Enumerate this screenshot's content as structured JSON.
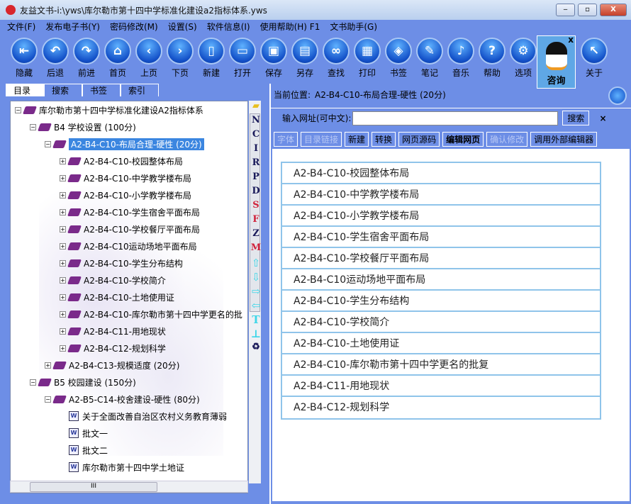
{
  "window": {
    "title": "友益文书-i:\\yws\\库尔勒市第十四中学标准化建设a2指标体系.yws",
    "min": "‒",
    "max": "▫",
    "close": "X"
  },
  "menu": [
    "文件(F)",
    "发布电子书(Y)",
    "密码修改(M)",
    "设置(S)",
    "软件信息(I)",
    "使用帮助(H) F1",
    "文书助手(G)"
  ],
  "toolbar": [
    {
      "label": "隐藏",
      "glyph": "⇤"
    },
    {
      "label": "后退",
      "glyph": "↶"
    },
    {
      "label": "前进",
      "glyph": "↷"
    },
    {
      "label": "首页",
      "glyph": "⌂"
    },
    {
      "label": "上页",
      "glyph": "‹"
    },
    {
      "label": "下页",
      "glyph": "›"
    },
    {
      "label": "新建",
      "glyph": "▯"
    },
    {
      "label": "打开",
      "glyph": "▭"
    },
    {
      "label": "保存",
      "glyph": "▣"
    },
    {
      "label": "另存",
      "glyph": "▤"
    },
    {
      "label": "查找",
      "glyph": "∞"
    },
    {
      "label": "打印",
      "glyph": "▦"
    },
    {
      "label": "书签",
      "glyph": "◈"
    },
    {
      "label": "笔记",
      "glyph": "✎"
    },
    {
      "label": "音乐",
      "glyph": "♪"
    },
    {
      "label": "帮助",
      "glyph": "?"
    },
    {
      "label": "选项",
      "glyph": "⚙"
    },
    {
      "label": "关于",
      "glyph": "↖"
    }
  ],
  "qq": {
    "label": "咨询",
    "close": "x"
  },
  "tabs": [
    "目录",
    "搜索",
    "书签",
    "索引"
  ],
  "tree": [
    {
      "level": 0,
      "pm": "−",
      "type": "book",
      "text": "库尔勒市第十四中学标准化建设A2指标体系"
    },
    {
      "level": 1,
      "pm": "−",
      "type": "book",
      "text": "B4 学校设置 (100分)"
    },
    {
      "level": 2,
      "pm": "−",
      "type": "open",
      "text": "A2-B4-C10-布局合理-硬性 (20分)",
      "selected": true
    },
    {
      "level": 3,
      "pm": "+",
      "type": "book",
      "text": "A2-B4-C10-校园整体布局"
    },
    {
      "level": 3,
      "pm": "+",
      "type": "book",
      "text": "A2-B4-C10-中学教学楼布局"
    },
    {
      "level": 3,
      "pm": "+",
      "type": "book",
      "text": "A2-B4-C10-小学教学楼布局"
    },
    {
      "level": 3,
      "pm": "+",
      "type": "book",
      "text": "A2-B4-C10-学生宿舍平面布局"
    },
    {
      "level": 3,
      "pm": "+",
      "type": "book",
      "text": "A2-B4-C10-学校餐厅平面布局"
    },
    {
      "level": 3,
      "pm": "+",
      "type": "book",
      "text": "A2-B4-C10运动场地平面布局"
    },
    {
      "level": 3,
      "pm": "+",
      "type": "book",
      "text": "A2-B4-C10-学生分布结构"
    },
    {
      "level": 3,
      "pm": "+",
      "type": "book",
      "text": "A2-B4-C10-学校简介"
    },
    {
      "level": 3,
      "pm": "+",
      "type": "book",
      "text": "A2-B4-C10-土地使用证"
    },
    {
      "level": 3,
      "pm": "+",
      "type": "book",
      "text": "A2-B4-C10-库尔勒市第十四中学更名的批"
    },
    {
      "level": 3,
      "pm": "+",
      "type": "book",
      "text": "A2-B4-C11-用地现状"
    },
    {
      "level": 3,
      "pm": "+",
      "type": "book",
      "text": "A2-B4-C12-规划科学"
    },
    {
      "level": 2,
      "pm": "+",
      "type": "book",
      "text": "A2-B4-C13-规模适度 (20分)"
    },
    {
      "level": 1,
      "pm": "−",
      "type": "book",
      "text": "B5 校园建设 (150分)"
    },
    {
      "level": 2,
      "pm": "−",
      "type": "book",
      "text": "A2-B5-C14-校舍建设-硬性 (80分)"
    },
    {
      "level": 3,
      "pm": "",
      "type": "doc",
      "text": "关于全面改善自治区农村义务教育薄弱"
    },
    {
      "level": 3,
      "pm": "",
      "type": "doc",
      "text": "批文一"
    },
    {
      "level": 3,
      "pm": "",
      "type": "doc",
      "text": "批文二"
    },
    {
      "level": 3,
      "pm": "",
      "type": "doc",
      "text": "库尔勒市第十四中学土地证"
    }
  ],
  "side_tools": [
    "N",
    "C",
    "I",
    "R",
    "P",
    "D",
    "S",
    "F",
    "Z",
    "M",
    "⇧",
    "⇩",
    "⇨",
    "⇦",
    "T",
    "⊥"
  ],
  "current_position": {
    "label": "当前位置:",
    "value": "A2-B4-C10-布局合理-硬性 (20分)"
  },
  "url_bar": {
    "label": "输入网址(可中文):",
    "value": "",
    "search": "搜索",
    "close": "×"
  },
  "edit_buttons": [
    {
      "label": "字体",
      "disabled": true
    },
    {
      "label": "目录链接",
      "disabled": true
    },
    {
      "label": "新建"
    },
    {
      "label": "转换"
    },
    {
      "label": "网页源码"
    },
    {
      "label": "编辑网页",
      "bold": true
    },
    {
      "label": "确认修改",
      "disabled": true
    },
    {
      "label": "调用外部编辑器"
    }
  ],
  "links": [
    "A2-B4-C10-校园整体布局",
    "A2-B4-C10-中学教学楼布局",
    "A2-B4-C10-小学教学楼布局",
    "A2-B4-C10-学生宿舍平面布局",
    "A2-B4-C10-学校餐厅平面布局",
    "A2-B4-C10运动场地平面布局",
    "A2-B4-C10-学生分布结构",
    "A2-B4-C10-学校简介",
    "A2-B4-C10-土地使用证",
    "A2-B4-C10-库尔勒市第十四中学更名的批复",
    "A2-B4-C11-用地现状",
    "A2-B4-C12-规划科学"
  ]
}
